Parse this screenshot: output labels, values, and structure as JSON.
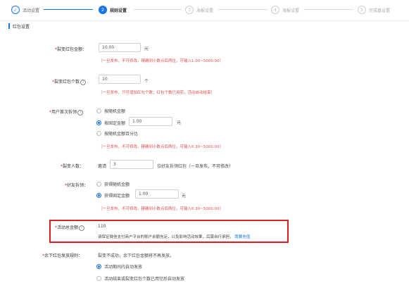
{
  "steps": [
    {
      "num": "✓",
      "label": "活动设置",
      "state": "done"
    },
    {
      "num": "2",
      "label": "规则设置",
      "state": "active"
    },
    {
      "num": "3",
      "label": "海报设置",
      "state": "todo"
    },
    {
      "num": "4",
      "label": "海报设置",
      "state": "todo"
    },
    {
      "num": "5",
      "label": "完成基设置",
      "state": "todo"
    }
  ],
  "colors": {
    "accent": "#1a73e8",
    "error": "#e34d4d",
    "highlight_border": "#e02020"
  },
  "section_title": "红包设置",
  "fields": {
    "amount": {
      "label": "裂变红包金额：",
      "value": "10.00",
      "unit": "元",
      "hint": "（一旦发布，不可修改。精确到小数点后两位，可输入1.00~5000.00）"
    },
    "count": {
      "label": "裂变红包个数",
      "value": "10",
      "unit": "个",
      "hint": "（一旦发布，只可增加红包个数；红包个数已用完，活动自动结束）"
    },
    "first_open": {
      "label": "用户首次拆领",
      "options": [
        "按随机金额",
        "按固定金额",
        "按随机金额百分比"
      ],
      "selected": 1,
      "value": "1.00",
      "unit": "元",
      "hint": "（一旦发布，不可修改。精确到小数点后两位，可输入0.30~5000.00）"
    },
    "people": {
      "label": "裂变人数：",
      "prefix": "邀请",
      "value": "3",
      "suffix": "位好友拆领红包（一旦发布，不可修改）"
    },
    "friend": {
      "label": "好友拆领：",
      "options": [
        "获得随机金额",
        "获得固定金额"
      ],
      "selected": 1,
      "value": "1.00",
      "unit": "元",
      "hint": "（一旦发布，不可修改。精确到小数点后两位，可输入0.30~5000.00）"
    },
    "activity_funds": {
      "label": "活动总金额",
      "value": "110",
      "note": "请保证微信支付商户平台的账户余额充足，以免影响活动效果，后需自行承担。",
      "link": "我要充值"
    },
    "leftover": {
      "label": "余下红包发放规则：",
      "desc": "裂变不成功，余下红包金额将不再发放。",
      "options": [
        "活动期间内自动发放",
        "活动结束或裂变红包个数已用完后自动发放"
      ],
      "selected": 0
    }
  }
}
